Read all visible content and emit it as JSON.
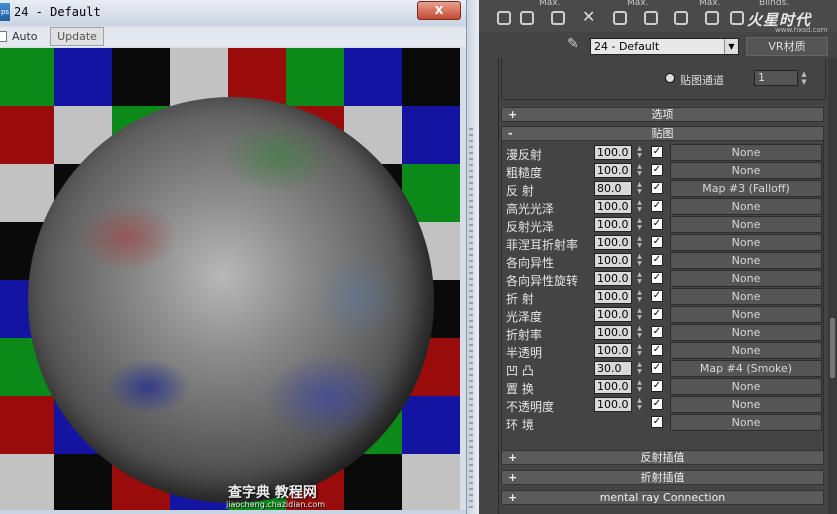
{
  "left_window": {
    "title": "24 - Default",
    "app_icon": "ps",
    "close_label": "X",
    "auto_label": "Auto",
    "update_label": "Update",
    "checker_colors": [
      "#c2c2c2",
      "#0b8a1a",
      "#1414a2",
      "#0a0a0a",
      "#9a0b0b"
    ]
  },
  "right_panel": {
    "header_fragments": [
      "Max.",
      "Max.",
      "Max.",
      "Blinds."
    ],
    "logo": "火星时代",
    "logo_url": "www.hxsd.com",
    "material_name": "24 - Default",
    "vr_button": "VR材质",
    "channel_label": "贴图通道",
    "channel_value": "1",
    "rollouts": {
      "options": {
        "sign": "+",
        "label": "选项"
      },
      "maps": {
        "sign": "-",
        "label": "贴图"
      },
      "reflect_interp": {
        "sign": "+",
        "label": "反射插值"
      },
      "refract_interp": {
        "sign": "+",
        "label": "折射插值"
      },
      "mental_ray": {
        "sign": "+",
        "label": "mental ray Connection"
      }
    },
    "maps": [
      {
        "label": "漫反射",
        "value": "100.0",
        "checked": true,
        "map": "None"
      },
      {
        "label": "粗糙度",
        "value": "100.0",
        "checked": true,
        "map": "None"
      },
      {
        "label": "反 射",
        "value": "80.0",
        "checked": true,
        "map": "Map #3 (Falloff)"
      },
      {
        "label": "高光光泽",
        "value": "100.0",
        "checked": true,
        "map": "None"
      },
      {
        "label": "反射光泽",
        "value": "100.0",
        "checked": true,
        "map": "None"
      },
      {
        "label": "菲涅耳折射率",
        "value": "100.0",
        "checked": true,
        "map": "None"
      },
      {
        "label": "各向异性",
        "value": "100.0",
        "checked": true,
        "map": "None"
      },
      {
        "label": "各向异性旋转",
        "value": "100.0",
        "checked": true,
        "map": "None"
      },
      {
        "label": "折 射",
        "value": "100.0",
        "checked": true,
        "map": "None"
      },
      {
        "label": "光泽度",
        "value": "100.0",
        "checked": true,
        "map": "None"
      },
      {
        "label": "折射率",
        "value": "100.0",
        "checked": true,
        "map": "None"
      },
      {
        "label": "半透明",
        "value": "100.0",
        "checked": true,
        "map": "None"
      },
      {
        "label": "凹 凸",
        "value": "30.0",
        "checked": true,
        "map": "Map #4 (Smoke)"
      },
      {
        "label": "置 换",
        "value": "100.0",
        "checked": true,
        "map": "None"
      },
      {
        "label": "不透明度",
        "value": "100.0",
        "checked": true,
        "map": "None"
      },
      {
        "label": "环 境",
        "value": "",
        "checked": true,
        "map": "None"
      }
    ],
    "watermark": "查字典 教程网",
    "watermark_url": "jiaocheng.chazidian.com"
  }
}
